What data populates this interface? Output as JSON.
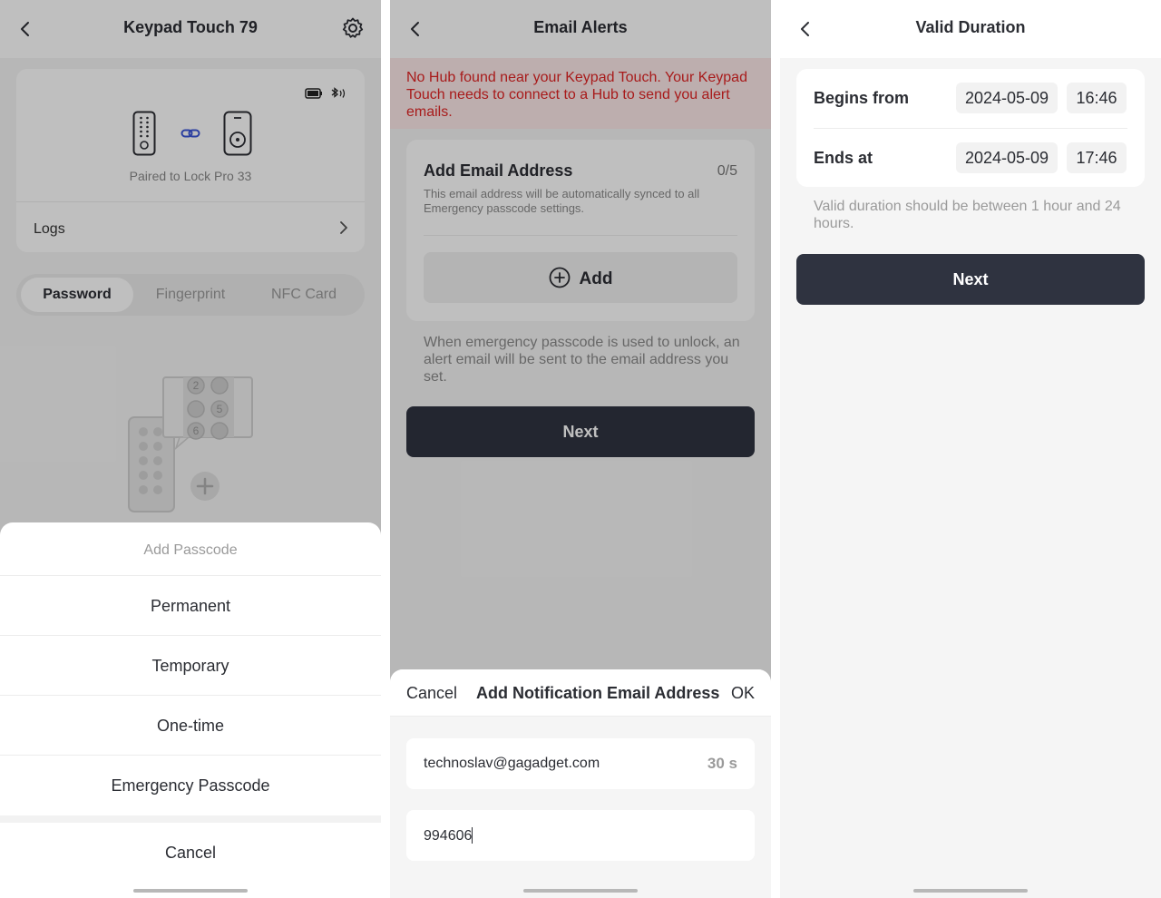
{
  "screen1": {
    "title": "Keypad Touch 79",
    "paired_text": "Paired to Lock Pro 33",
    "logs_label": "Logs",
    "tabs": [
      "Password",
      "Fingerprint",
      "NFC Card"
    ],
    "sheet": {
      "title": "Add Passcode",
      "options": [
        "Permanent",
        "Temporary",
        "One-time",
        "Emergency Passcode"
      ],
      "cancel": "Cancel"
    }
  },
  "screen2": {
    "title": "Email Alerts",
    "warning": "No Hub found near your Keypad Touch. Your Keypad Touch needs to connect to a Hub to send you alert emails.",
    "card": {
      "title": "Add Email Address",
      "count": "0/5",
      "description": "This email address will be automatically synced to all Emergency passcode settings.",
      "add_label": "Add"
    },
    "hint": "When emergency passcode is used to unlock, an alert email will be sent to the email address you set.",
    "next_label": "Next",
    "sheet": {
      "cancel": "Cancel",
      "title": "Add Notification Email Address",
      "ok": "OK",
      "email_value": "technoslav@gagadget.com",
      "timer": "30 s",
      "code_value": "994606"
    }
  },
  "screen3": {
    "title": "Valid Duration",
    "begins_label": "Begins from",
    "begins_date": "2024-05-09",
    "begins_time": "16:46",
    "ends_label": "Ends at",
    "ends_date": "2024-05-09",
    "ends_time": "17:46",
    "hint": "Valid duration should be between 1 hour and 24 hours.",
    "next_label": "Next"
  },
  "icons": [
    "back-icon",
    "gear-icon",
    "battery-icon",
    "bluetooth-icon",
    "keypad-device-icon",
    "link-icon",
    "lock-device-icon",
    "chevron-right-icon",
    "plus-circle-icon"
  ],
  "colors": {
    "warning": "#e02424",
    "primary_button": "#2f3340",
    "overlay": "rgba(0,0,0,0.25)"
  }
}
